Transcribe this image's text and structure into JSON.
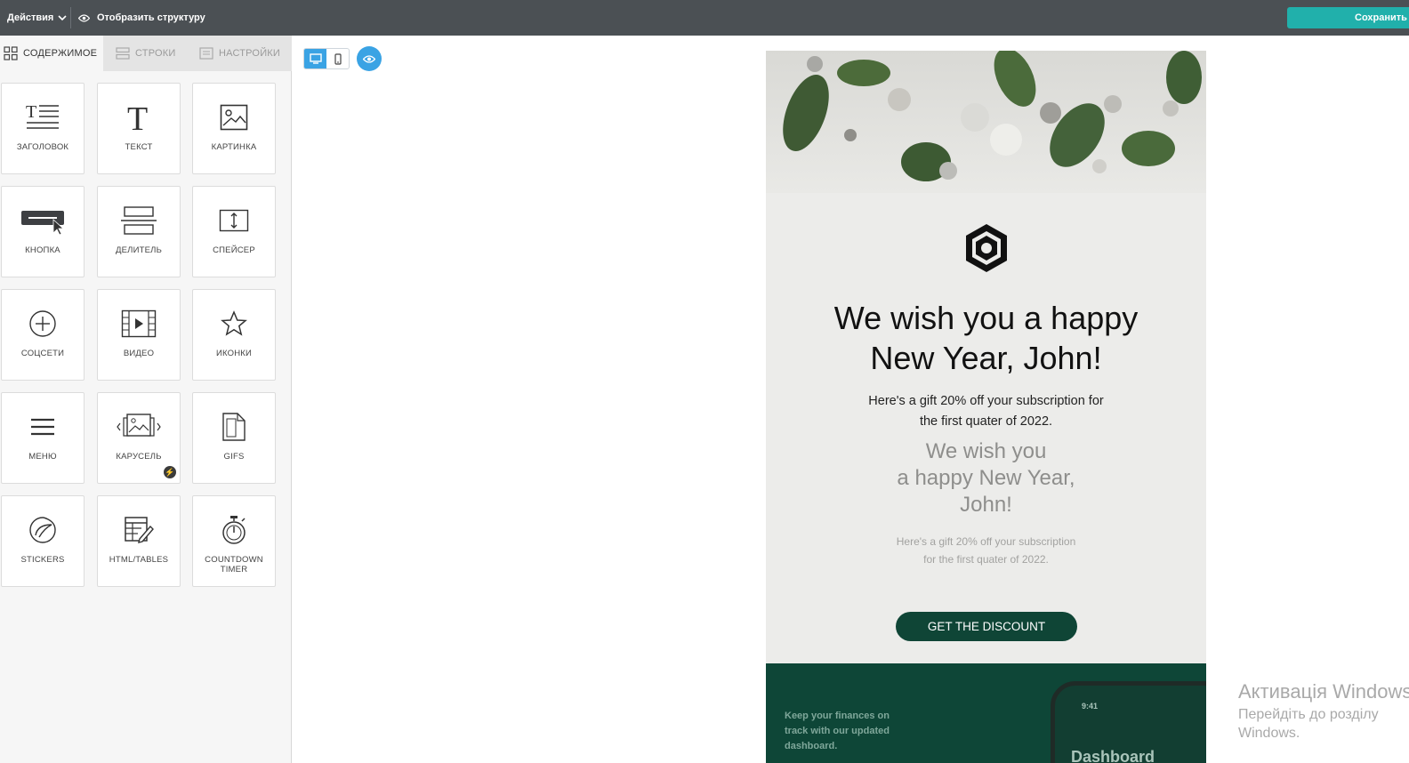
{
  "topbar": {
    "actions_label": "Действия",
    "structure_label": "Отобразить структуру",
    "save_label": "Сохранить"
  },
  "sidebar": {
    "tabs": [
      {
        "label": "СОДЕРЖИМОЕ",
        "icon": "grid-icon"
      },
      {
        "label": "СТРОКИ",
        "icon": "rows-icon"
      },
      {
        "label": "НАСТРОЙКИ",
        "icon": "settings-list-icon"
      }
    ],
    "tiles": [
      {
        "label": "ЗАГОЛОВОК",
        "icon": "heading-icon"
      },
      {
        "label": "ТЕКСТ",
        "icon": "text-icon"
      },
      {
        "label": "КАРТИНКА",
        "icon": "image-icon"
      },
      {
        "label": "КНОПКА",
        "icon": "button-icon"
      },
      {
        "label": "ДЕЛИТЕЛЬ",
        "icon": "divider-icon"
      },
      {
        "label": "СПЕЙСЕР",
        "icon": "spacer-icon"
      },
      {
        "label": "СОЦСЕТИ",
        "icon": "social-plus-icon"
      },
      {
        "label": "ВИДЕО",
        "icon": "video-icon"
      },
      {
        "label": "ИКОНКИ",
        "icon": "star-icon"
      },
      {
        "label": "МЕНЮ",
        "icon": "menu-icon"
      },
      {
        "label": "КАРУСЕЛЬ",
        "icon": "carousel-icon"
      },
      {
        "label": "GIFS",
        "icon": "gif-file-icon"
      },
      {
        "label": "STICKERS",
        "icon": "sticker-icon"
      },
      {
        "label": "HTML/TABLES",
        "icon": "html-table-icon"
      },
      {
        "label": "COUNTDOWN TIMER",
        "icon": "stopwatch-icon"
      }
    ]
  },
  "canvas": {
    "device_desktop_icon": "desktop-icon",
    "device_mobile_icon": "mobile-icon",
    "preview_icon": "eye-icon"
  },
  "email": {
    "headline_line1": "We wish you a happy",
    "headline_line2": "New Year, John!",
    "subtext": "Here's a gift 20% off your subscription for the first quater of 2022.",
    "ghost_headline_line1": "We wish you",
    "ghost_headline_line2": "a happy New Year,",
    "ghost_headline_line3": "John!",
    "ghost_subtext": "Here's a gift 20% off your subscription for the first quater of 2022.",
    "cta_label": "GET THE DISCOUNT",
    "band_text": "Keep your finances on track with our updated dashboard.",
    "phone_time": "9:41",
    "phone_title": "Dashboard",
    "colors": {
      "cta": "#0f4536",
      "band": "#0e4637",
      "accent": "#21b0ab",
      "device_active": "#3aa3e4"
    }
  },
  "os_overlay": {
    "title": "Активація Windows",
    "line1": "Перейдіть до розділу",
    "line2": "Windows."
  }
}
